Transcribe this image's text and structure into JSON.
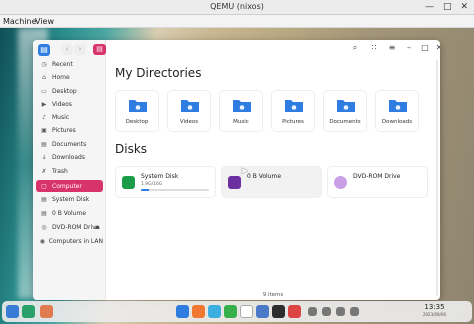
{
  "qemu": {
    "title": "QEMU (nixos)",
    "menu": [
      "Machine",
      "View"
    ],
    "controls": {
      "minimize": "—",
      "maximize": "□",
      "close": "✕"
    }
  },
  "sidebar": {
    "items": [
      {
        "label": "Recent",
        "icon": "clock-icon",
        "glyph": "◷"
      },
      {
        "label": "Home",
        "icon": "home-icon",
        "glyph": "⌂"
      },
      {
        "label": "Desktop",
        "icon": "desktop-icon",
        "glyph": "▭"
      },
      {
        "label": "Videos",
        "icon": "video-icon",
        "glyph": "▶"
      },
      {
        "label": "Music",
        "icon": "music-icon",
        "glyph": "♪"
      },
      {
        "label": "Pictures",
        "icon": "picture-icon",
        "glyph": "▣"
      },
      {
        "label": "Documents",
        "icon": "document-icon",
        "glyph": "▤"
      },
      {
        "label": "Downloads",
        "icon": "download-icon",
        "glyph": "↓"
      },
      {
        "label": "Trash",
        "icon": "trash-icon",
        "glyph": "✗"
      },
      {
        "label": "Computer",
        "icon": "computer-icon",
        "glyph": "▢",
        "active": true
      },
      {
        "label": "System Disk",
        "icon": "disk-icon",
        "glyph": "▤"
      },
      {
        "label": "0 B Volume",
        "icon": "disk-icon",
        "glyph": "▤"
      },
      {
        "label": "DVD-ROM Drive",
        "icon": "disc-icon",
        "glyph": "◎",
        "eject": "⏏"
      },
      {
        "label": "Computers in LAN",
        "icon": "network-icon",
        "glyph": "◉"
      }
    ]
  },
  "toolbar": {
    "back": "‹",
    "forward": "›",
    "view_glyph": "▤",
    "search_glyph": "⌕",
    "grid_glyph": "∷",
    "menu_glyph": "≡",
    "min_glyph": "–",
    "max_glyph": "□",
    "close_glyph": "✕"
  },
  "main": {
    "directories_title": "My Directories",
    "directories": [
      {
        "label": "Desktop",
        "icon": "desktop-folder-icon"
      },
      {
        "label": "Videos",
        "icon": "videos-folder-icon"
      },
      {
        "label": "Music",
        "icon": "music-folder-icon"
      },
      {
        "label": "Pictures",
        "icon": "pictures-folder-icon"
      },
      {
        "label": "Documents",
        "icon": "documents-folder-icon"
      },
      {
        "label": "Downloads",
        "icon": "downloads-folder-icon"
      }
    ],
    "disks_title": "Disks",
    "disks": [
      {
        "label": "System Disk",
        "size": "1.9G/16G",
        "usage_fraction": 0.12,
        "color": "#1a9c48"
      },
      {
        "label": "0 B Volume",
        "size": "",
        "color": "#6b2fa0"
      },
      {
        "label": "DVD-ROM Drive",
        "size": "",
        "color": "#c9a0e6"
      }
    ],
    "status": "9 items"
  },
  "taskbar": {
    "apps": [
      {
        "name": "launcher-icon",
        "color": "#3a7bd5"
      },
      {
        "name": "multitask-icon",
        "color": "#2aa06a"
      },
      {
        "name": "workspace-icon",
        "color": "#e07a4f"
      },
      {
        "name": "file-manager-icon",
        "color": "#2f7de1"
      },
      {
        "name": "gallery-icon",
        "color": "#f07830"
      },
      {
        "name": "image-viewer-icon",
        "color": "#3bb0e0"
      },
      {
        "name": "app-store-icon",
        "color": "#35b04a"
      },
      {
        "name": "calendar-icon",
        "color": "#ffffff"
      },
      {
        "name": "settings-icon",
        "color": "#4a7ac8"
      },
      {
        "name": "music-app-icon",
        "color": "#2d2d2d"
      },
      {
        "name": "terminal-icon",
        "color": "#d44"
      },
      {
        "name": "tray-icon-1",
        "color": "#777777"
      },
      {
        "name": "tray-icon-2",
        "color": "#777777"
      },
      {
        "name": "tray-icon-3",
        "color": "#777777"
      },
      {
        "name": "tray-icon-4",
        "color": "#777777"
      }
    ],
    "time": "13:35",
    "date": "2023/09/06"
  },
  "colors": {
    "accent": "#d8336a",
    "folder": "#2f7de1"
  }
}
